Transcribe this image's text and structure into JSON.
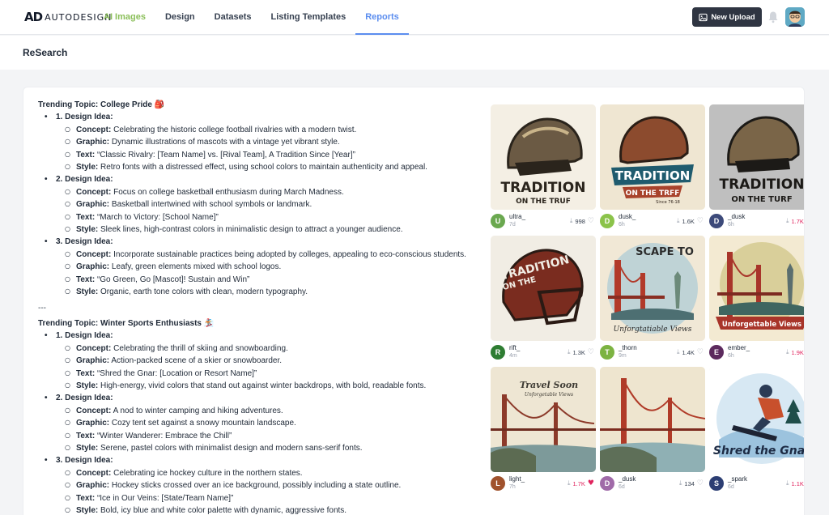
{
  "brand": {
    "mark": "AD",
    "name": "AUTODESIGN"
  },
  "nav": [
    {
      "label": "AI Images"
    },
    {
      "label": "Design"
    },
    {
      "label": "Datasets"
    },
    {
      "label": "Listing Templates"
    },
    {
      "label": "Reports"
    }
  ],
  "header": {
    "upload_label": "New Upload"
  },
  "page": {
    "title": "ReSearch"
  },
  "colors": {
    "accent": "#5b8def",
    "ai_accent": "#8bbf5a",
    "like": "#e0245e"
  },
  "content": {
    "topics": [
      {
        "title": "Trending Topic: College Pride",
        "emoji": "🎒",
        "ideas": [
          {
            "label": "1. Design Idea:",
            "points": [
              {
                "key": "Concept:",
                "text": "Celebrating the historic college football rivalries with a modern twist."
              },
              {
                "key": "Graphic:",
                "text": "Dynamic illustrations of mascots with a vintage yet vibrant style."
              },
              {
                "key": "Text:",
                "text": "“Classic Rivalry: [Team Name] vs. [Rival Team], A Tradition Since [Year]”"
              },
              {
                "key": "Style:",
                "text": "Retro fonts with a distressed effect, using school colors to maintain authenticity and appeal."
              }
            ]
          },
          {
            "label": "2. Design Idea:",
            "points": [
              {
                "key": "Concept:",
                "text": "Focus on college basketball enthusiasm during March Madness."
              },
              {
                "key": "Graphic:",
                "text": "Basketball intertwined with school symbols or landmark."
              },
              {
                "key": "Text:",
                "text": "“March to Victory: [School Name]”"
              },
              {
                "key": "Style:",
                "text": "Sleek lines, high-contrast colors in minimalistic design to attract a younger audience."
              }
            ]
          },
          {
            "label": "3. Design Idea:",
            "points": [
              {
                "key": "Concept:",
                "text": "Incorporate sustainable practices being adopted by colleges, appealing to eco-conscious students."
              },
              {
                "key": "Graphic:",
                "text": "Leafy, green elements mixed with school logos."
              },
              {
                "key": "Text:",
                "text": "“Go Green, Go [Mascot]! Sustain and Win”"
              },
              {
                "key": "Style:",
                "text": "Organic, earth tone colors with clean, modern typography."
              }
            ]
          }
        ]
      },
      {
        "title": "Trending Topic: Winter Sports Enthusiasts",
        "emoji": "🏂",
        "ideas": [
          {
            "label": "1. Design Idea:",
            "points": [
              {
                "key": "Concept:",
                "text": "Celebrating the thrill of skiing and snowboarding."
              },
              {
                "key": "Graphic:",
                "text": "Action-packed scene of a skier or snowboarder."
              },
              {
                "key": "Text:",
                "text": "“Shred the Gnar: [Location or Resort Name]”"
              },
              {
                "key": "Style:",
                "text": "High-energy, vivid colors that stand out against winter backdrops, with bold, readable fonts."
              }
            ]
          },
          {
            "label": "2. Design Idea:",
            "points": [
              {
                "key": "Concept:",
                "text": "A nod to winter camping and hiking adventures."
              },
              {
                "key": "Graphic:",
                "text": "Cozy tent set against a snowy mountain landscape."
              },
              {
                "key": "Text:",
                "text": "“Winter Wanderer: Embrace the Chill”"
              },
              {
                "key": "Style:",
                "text": "Serene, pastel colors with minimalist design and modern sans-serif fonts."
              }
            ]
          },
          {
            "label": "3. Design Idea:",
            "points": [
              {
                "key": "Concept:",
                "text": "Celebrating ice hockey culture in the northern states."
              },
              {
                "key": "Graphic:",
                "text": "Hockey sticks crossed over an ice background, possibly including a state outline."
              },
              {
                "key": "Text:",
                "text": "“Ice in Our Veins: [State/Team Name]”"
              },
              {
                "key": "Style:",
                "text": "Bold, icy blue and white color palette with dynamic, aggressive fonts."
              }
            ]
          }
        ]
      }
    ],
    "separator": "---"
  },
  "gallery": [
    {
      "theme": "helmet",
      "art": [
        "TRADITION",
        "ON THE TRUF"
      ],
      "avatar": "U",
      "avatar_color": "#6aa84f",
      "user": "ultra_",
      "time": "7d",
      "downloads": "998",
      "liked": false
    },
    {
      "theme": "helmet-banner",
      "art": [
        "TRADITION",
        "ON THE TRFF",
        "Since 76-18"
      ],
      "avatar": "D",
      "avatar_color": "#8bc34a",
      "user": "dusk_",
      "time": "6h",
      "downloads": "1.6K",
      "liked": false
    },
    {
      "theme": "helmet-grey",
      "art": [
        "TRADITION",
        "ON THE TURF"
      ],
      "avatar": "D",
      "avatar_color": "#3d4a7a",
      "user": "_dusk",
      "time": "6h",
      "downloads": "1.7K",
      "liked": true
    },
    {
      "theme": "helmet-red",
      "art": [
        "TRADITION",
        "ON THE"
      ],
      "avatar": "R",
      "avatar_color": "#2e7d32",
      "user": "rift_",
      "time": "4m",
      "downloads": "1.3K",
      "liked": false
    },
    {
      "theme": "bridge",
      "art": [
        "SCAPE TO",
        "Unforgtatiable Views"
      ],
      "avatar": "T",
      "avatar_color": "#7cb342",
      "user": "_thorn",
      "time": "9m",
      "downloads": "1.4K",
      "liked": false
    },
    {
      "theme": "bridge-banner",
      "art": [
        "Unforgettable Views"
      ],
      "avatar": "E",
      "avatar_color": "#5c2a5e",
      "user": "ember_",
      "time": "6h",
      "downloads": "1.9K",
      "liked": true
    },
    {
      "theme": "bridge-sketch",
      "art": [
        "Travel Soon",
        "Unforgetable Views"
      ],
      "avatar": "L",
      "avatar_color": "#a0522d",
      "user": "light_",
      "time": "7h",
      "downloads": "1.7K",
      "liked": true
    },
    {
      "theme": "bridge-plain",
      "art": [],
      "avatar": "D",
      "avatar_color": "#a06aa8",
      "user": "_dusk",
      "time": "6d",
      "downloads": "134",
      "liked": false
    },
    {
      "theme": "snowboard",
      "art": [
        "Shred the Gnar"
      ],
      "avatar": "S",
      "avatar_color": "#2c3e73",
      "user": "_spark",
      "time": "6d",
      "downloads": "1.1K",
      "liked": true
    }
  ]
}
